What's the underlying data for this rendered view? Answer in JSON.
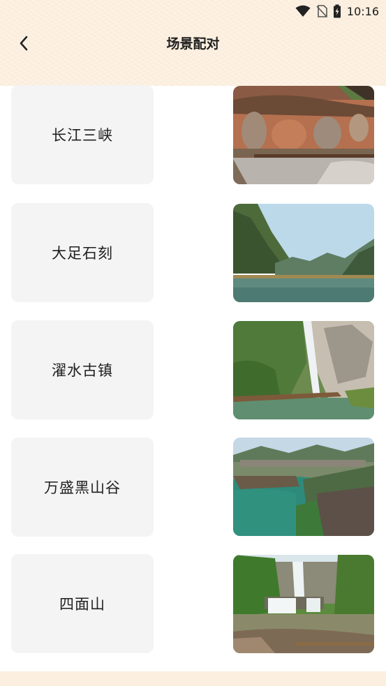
{
  "status_bar": {
    "time": "10:16",
    "icons": [
      "wifi-icon",
      "no-sim-icon",
      "battery-icon"
    ]
  },
  "header": {
    "title": "场景配对",
    "back_icon": "chevron-left-icon"
  },
  "colors": {
    "header_bg": "#fcefdf",
    "card_bg": "#f4f4f4",
    "text": "#1f1f1f"
  },
  "pairs": [
    {
      "name": "长江三峡",
      "image": "cliff-buddha-carving-photo"
    },
    {
      "name": "大足石刻",
      "image": "river-gorge-photo"
    },
    {
      "name": "濯水古镇",
      "image": "cliff-waterfall-photo"
    },
    {
      "name": "万盛黑山谷",
      "image": "river-town-bridge-photo"
    },
    {
      "name": "四面山",
      "image": "forest-waterfall-photo"
    }
  ]
}
